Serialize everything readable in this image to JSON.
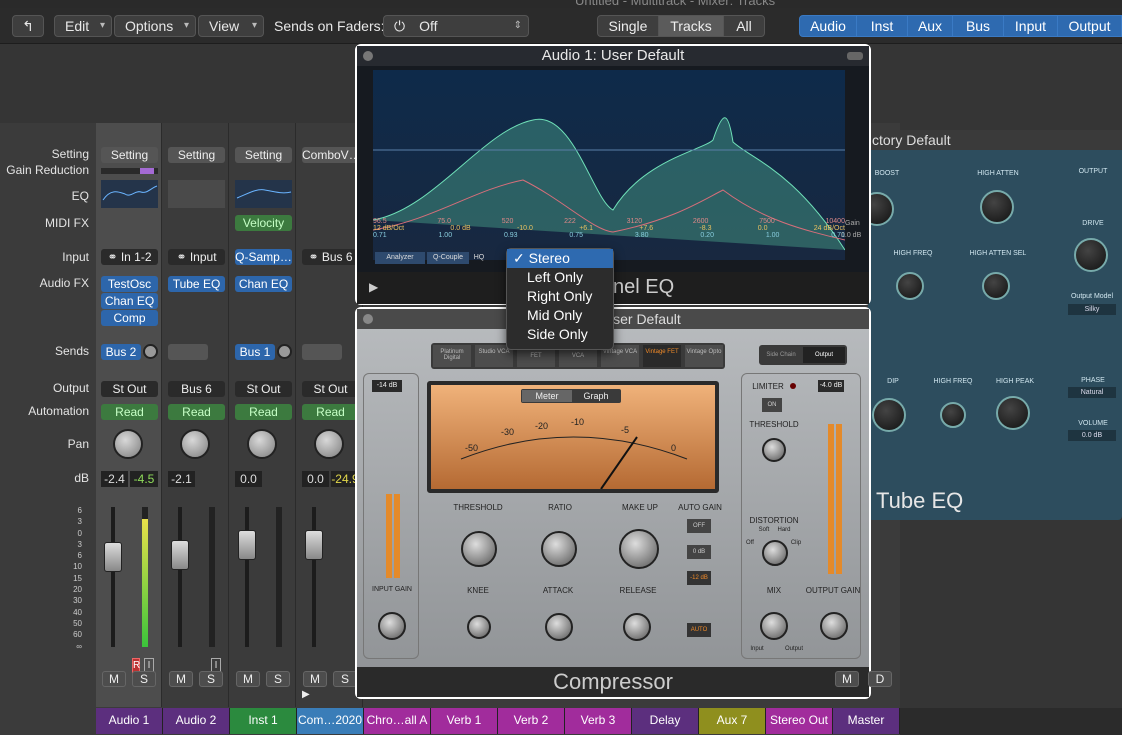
{
  "window": {
    "title": "Untitled - Multitrack - Mixer: Tracks"
  },
  "toolbar": {
    "edit": "Edit",
    "options": "Options",
    "view": "View",
    "sends_label": "Sends on Faders:",
    "sends_value": "Off",
    "single": "Single",
    "tracks": "Tracks",
    "all": "All",
    "filters": [
      "Audio",
      "Inst",
      "Aux",
      "Bus",
      "Input",
      "Output"
    ]
  },
  "row_labels": {
    "setting": "Setting",
    "gain_reduction": "Gain Reduction",
    "eq": "EQ",
    "midi_fx": "MIDI FX",
    "input": "Input",
    "audio_fx": "Audio FX",
    "sends": "Sends",
    "output": "Output",
    "automation": "Automation",
    "pan": "Pan",
    "db": "dB"
  },
  "strips": [
    {
      "setting": "Setting",
      "input": "In 1-2",
      "fx": [
        "TestOsc",
        "Chan EQ",
        "Comp"
      ],
      "send": "Bus 2",
      "output": "St Out",
      "auto": "Read",
      "db1": "-2.4",
      "db2": "-4.5",
      "name": "Audio 1",
      "color": "#5c2f7e"
    },
    {
      "setting": "Setting",
      "input": "Input",
      "fx": [
        "Tube EQ"
      ],
      "send": "",
      "output": "Bus 6",
      "auto": "Read",
      "db1": "-2.1",
      "db2": "",
      "name": "Audio 2",
      "color": "#5c2f7e"
    },
    {
      "setting": "Setting",
      "midifx": "Velocity",
      "input": "Q-Samp…",
      "fx": [
        "Chan EQ"
      ],
      "send": "Bus 1",
      "output": "St Out",
      "auto": "Read",
      "db1": "0.0",
      "db2": "",
      "name": "Inst 1",
      "color": "#2b8a3e"
    },
    {
      "setting": "ComboV…",
      "input": "Bus 6",
      "fx": [],
      "send": "",
      "output": "St Out",
      "auto": "Read",
      "db1": "0.0",
      "db2": "-24.9",
      "name": "Com…2020",
      "color": "#3a7db8"
    }
  ],
  "bottom_names": [
    {
      "name": "Chro…all A",
      "color": "#a12c9c"
    },
    {
      "name": "Verb 1",
      "color": "#a12c9c"
    },
    {
      "name": "Verb 2",
      "color": "#a12c9c"
    },
    {
      "name": "Verb 3",
      "color": "#a12c9c"
    },
    {
      "name": "Delay",
      "color": "#5c2f7e"
    },
    {
      "name": "Aux 7",
      "color": "#8f8f1e"
    },
    {
      "name": "Stereo Out",
      "color": "#a12c9c"
    },
    {
      "name": "Master",
      "color": "#5c2f7e"
    }
  ],
  "fader_scale": [
    "6",
    "3",
    "0",
    "3",
    "6",
    "10",
    "15",
    "20",
    "30",
    "40",
    "50",
    "60",
    "∞"
  ],
  "mute": "M",
  "solo": "S",
  "rec": "R",
  "input_mon": "I",
  "eq": {
    "title": "Audio 1: User Default",
    "plugin_name": "nel EQ",
    "freqs": [
      "96.5",
      "75.0",
      "520",
      "222",
      "3120",
      "2600",
      "7500",
      "10400"
    ],
    "gains": [
      "12 dB/Oct",
      "0.0 dB",
      "-10.0",
      "+6.1",
      "+7.6",
      "-8.3",
      "0.0",
      "24 dB/Oct"
    ],
    "qs": [
      "0.71",
      "1.00",
      "0.93",
      "0.75",
      "3.80",
      "0.20",
      "1.00",
      "0.71"
    ],
    "analyzer": "Analyzer",
    "qcouple": "Q-Couple",
    "hq": "HQ",
    "gain_label": "Gain",
    "gain_value": "0.0 dB"
  },
  "dropdown": {
    "items": [
      "Stereo",
      "Left Only",
      "Right Only",
      "Mid Only",
      "Side Only"
    ],
    "selected": "Stereo",
    "check": "✓"
  },
  "compressor": {
    "title": "User Default",
    "name": "Compressor",
    "models": [
      "Platinum Digital",
      "Studio VCA",
      "FET",
      "VCA",
      "Vintage VCA",
      "Vintage FET",
      "Vintage Opto"
    ],
    "side_chain": "Side Chain",
    "output_btn": "Output",
    "in_db": "-14 dB",
    "out_db": "-4.0 dB",
    "meter_tab": "Meter",
    "graph_tab": "Graph",
    "meter_scale": [
      "-50",
      "-30",
      "-20",
      "-10",
      "-5",
      "0"
    ],
    "threshold": "THRESHOLD",
    "ratio": "RATIO",
    "makeup": "MAKE UP",
    "autogain": "AUTO GAIN",
    "knee": "KNEE",
    "attack": "ATTACK",
    "release": "RELEASE",
    "off": "OFF",
    "odb": "0 dB",
    "m12": "-12 dB",
    "auto": "AUTO",
    "limiter": "LIMITER",
    "on": "ON",
    "threshold2": "THRESHOLD",
    "distortion": "DISTORTION",
    "soft": "Soft",
    "hard": "Hard",
    "clip": "Clip",
    "doff": "Off",
    "mix": "MIX",
    "input": "Input",
    "output": "Output",
    "input_gain": "INPUT GAIN",
    "output_gain": "OUTPUT GAIN"
  },
  "tube": {
    "title": "ctory Default",
    "name": "Tube EQ",
    "boost": "BOOST",
    "high_atten": "HIGH ATTEN",
    "output": "OUTPUT",
    "drive": "DRIVE",
    "high_freq": "HIGH FREQ",
    "high_atten_sel": "HIGH ATTEN SEL",
    "output_model": "Output Model",
    "silky": "Silky",
    "dip": "DIP",
    "high_freq2": "HIGH FREQ",
    "high_peak": "HIGH PEAK",
    "phase": "PHASE",
    "natural": "Natural",
    "volume": "VOLUME",
    "vol_value": "0.0 dB"
  }
}
